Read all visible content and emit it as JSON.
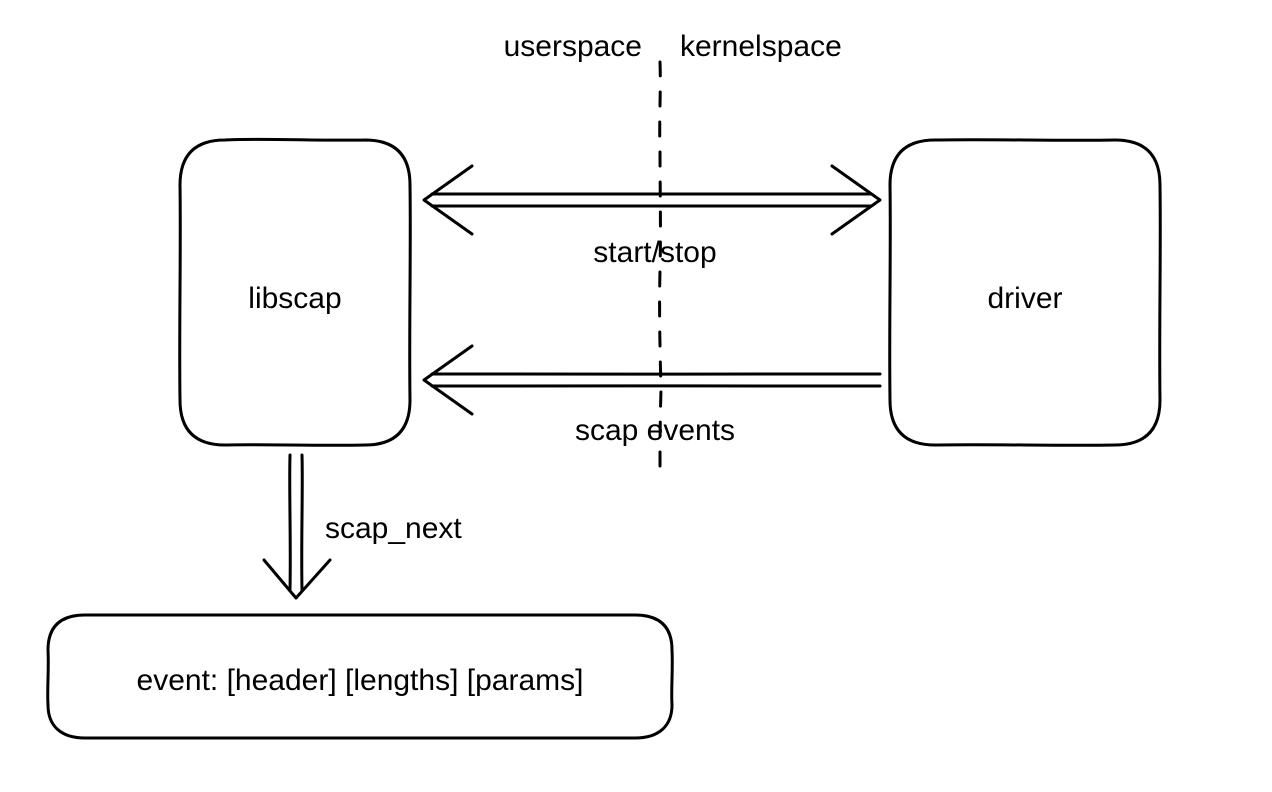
{
  "labels": {
    "userspace": "userspace",
    "kernelspace": "kernelspace",
    "libscap": "libscap",
    "driver": "driver",
    "start_stop": "start/stop",
    "scap_events": "scap events",
    "scap_next": "scap_next",
    "event_box": "event: [header] [lengths] [params]"
  }
}
